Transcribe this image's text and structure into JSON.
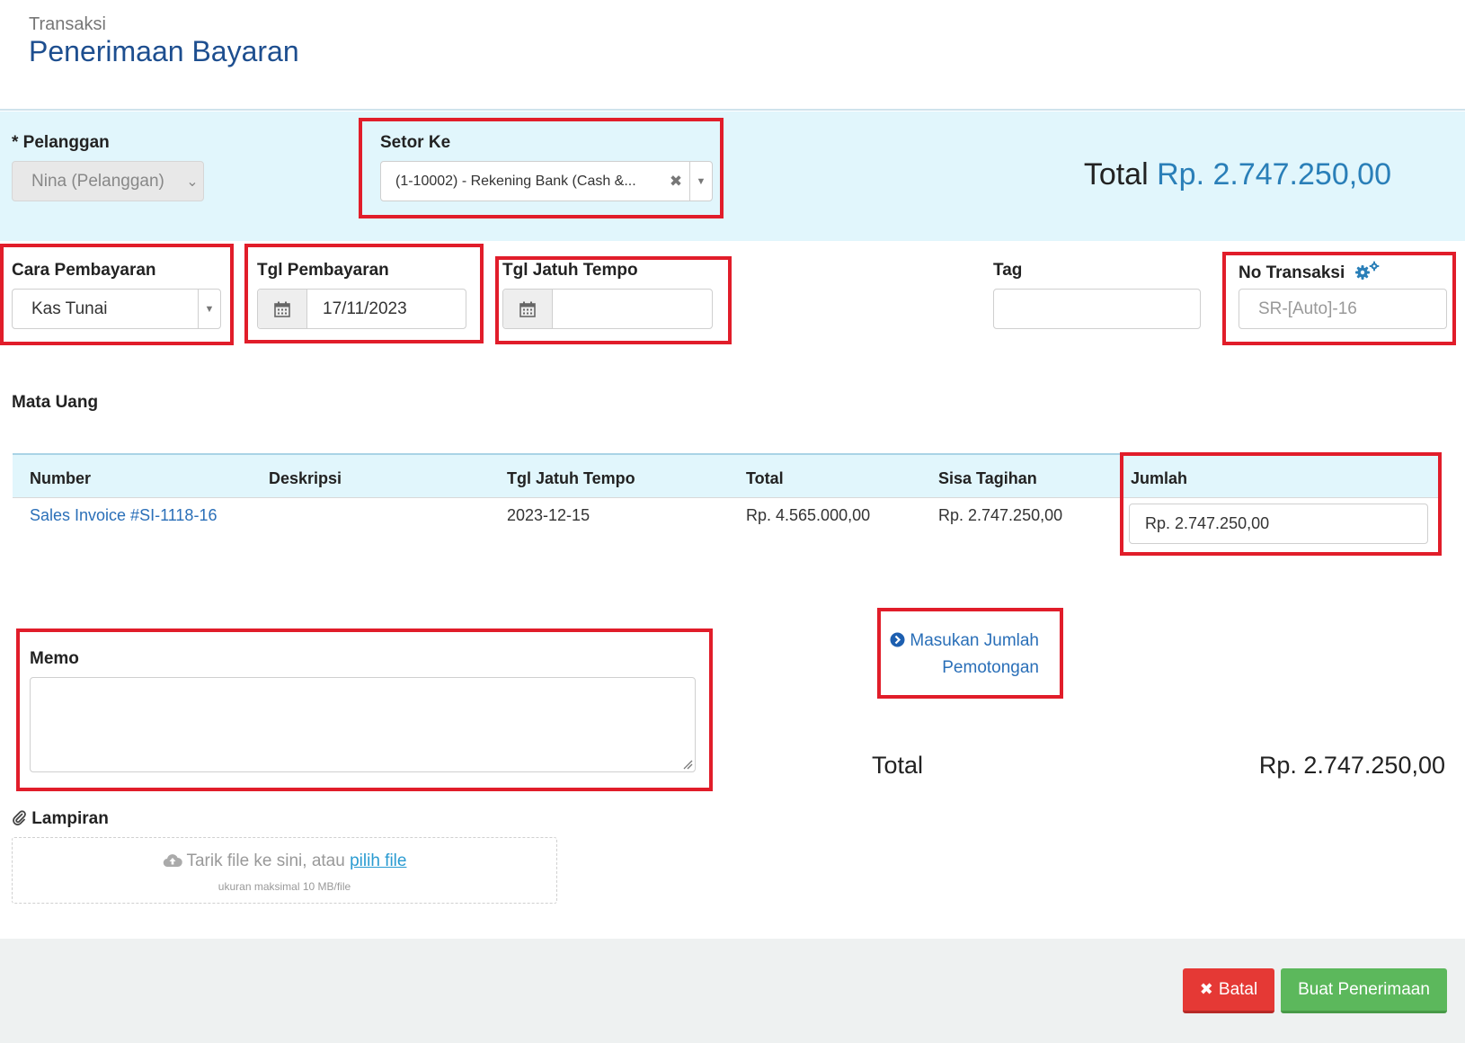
{
  "header": {
    "breadcrumb": "Transaksi",
    "title": "Penerimaan Bayaran"
  },
  "customer": {
    "label": "* Pelanggan",
    "value": "Nina (Pelanggan)"
  },
  "deposit_to": {
    "label": "Setor Ke",
    "value": "(1-10002) - Rekening Bank (Cash &..."
  },
  "grand_total": {
    "label": "Total",
    "amount": "Rp. 2.747.250,00"
  },
  "payment_method": {
    "label": "Cara Pembayaran",
    "value": "Kas Tunai"
  },
  "payment_date": {
    "label": "Tgl Pembayaran",
    "value": "17/11/2023"
  },
  "due_date": {
    "label": "Tgl Jatuh Tempo",
    "value": ""
  },
  "tag": {
    "label": "Tag",
    "value": ""
  },
  "transaction_no": {
    "label": "No Transaksi",
    "placeholder": "SR-[Auto]-16"
  },
  "currency": {
    "label": "Mata Uang"
  },
  "table": {
    "headers": [
      "Number",
      "Deskripsi",
      "Tgl Jatuh Tempo",
      "Total",
      "Sisa Tagihan",
      "Jumlah"
    ],
    "rows": [
      {
        "number": "Sales Invoice #SI-1118-16",
        "description": "",
        "due_date": "2023-12-15",
        "total": "Rp. 4.565.000,00",
        "remaining": "Rp. 2.747.250,00",
        "amount": "Rp. 2.747.250,00"
      }
    ]
  },
  "memo": {
    "label": "Memo",
    "value": ""
  },
  "deduction_link": {
    "line1": "Masukan Jumlah",
    "line2": "Pemotongan"
  },
  "summary": {
    "label": "Total",
    "amount": "Rp. 2.747.250,00"
  },
  "attachment": {
    "label": "Lampiran",
    "drop_text": "Tarik file ke sini, atau",
    "pick_link": "pilih file",
    "size_note": "ukuran maksimal 10 MB/file"
  },
  "actions": {
    "cancel": "Batal",
    "submit": "Buat Penerimaan"
  },
  "colors": {
    "accent": "#1d4e8f",
    "link": "#2a6fb8",
    "highlight": "#e11d2a",
    "band": "#e1f6fc",
    "cancel": "#e53935",
    "submit": "#5cb85c"
  }
}
